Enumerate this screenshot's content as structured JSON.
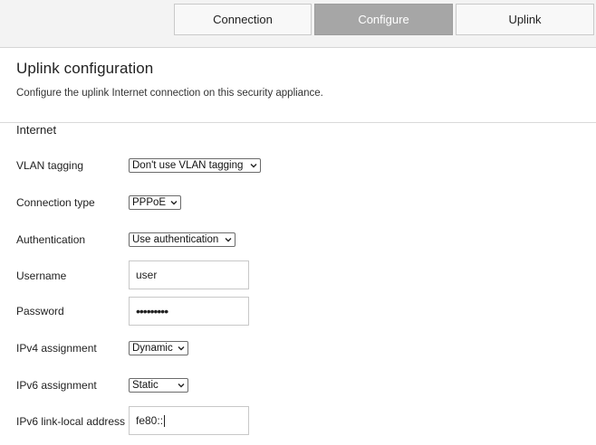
{
  "tabs": [
    {
      "label": "Connection",
      "active": false
    },
    {
      "label": "Configure",
      "active": true
    },
    {
      "label": "Uplink",
      "active": false
    }
  ],
  "page": {
    "title": "Uplink configuration",
    "description": "Configure the uplink Internet connection on this security appliance."
  },
  "section": {
    "title": "Internet"
  },
  "fields": {
    "vlan_tagging": {
      "label": "VLAN tagging",
      "value": "Don't use VLAN tagging"
    },
    "connection_type": {
      "label": "Connection type",
      "value": "PPPoE"
    },
    "authentication": {
      "label": "Authentication",
      "value": "Use authentication"
    },
    "username": {
      "label": "Username",
      "value": "user"
    },
    "password": {
      "label": "Password",
      "value": "•••••••••"
    },
    "ipv4_assignment": {
      "label": "IPv4 assignment",
      "value": "Dynamic"
    },
    "ipv6_assignment": {
      "label": "IPv6 assignment",
      "value": "Static"
    },
    "ipv6_link_local": {
      "label": "IPv6 link-local address",
      "value": "fe80::"
    }
  },
  "colors": {
    "active_tab": "#a6a6a6",
    "tab_bar": "#f3f3f3"
  },
  "icons": {
    "select_chevron": "chevron-down-icon"
  }
}
